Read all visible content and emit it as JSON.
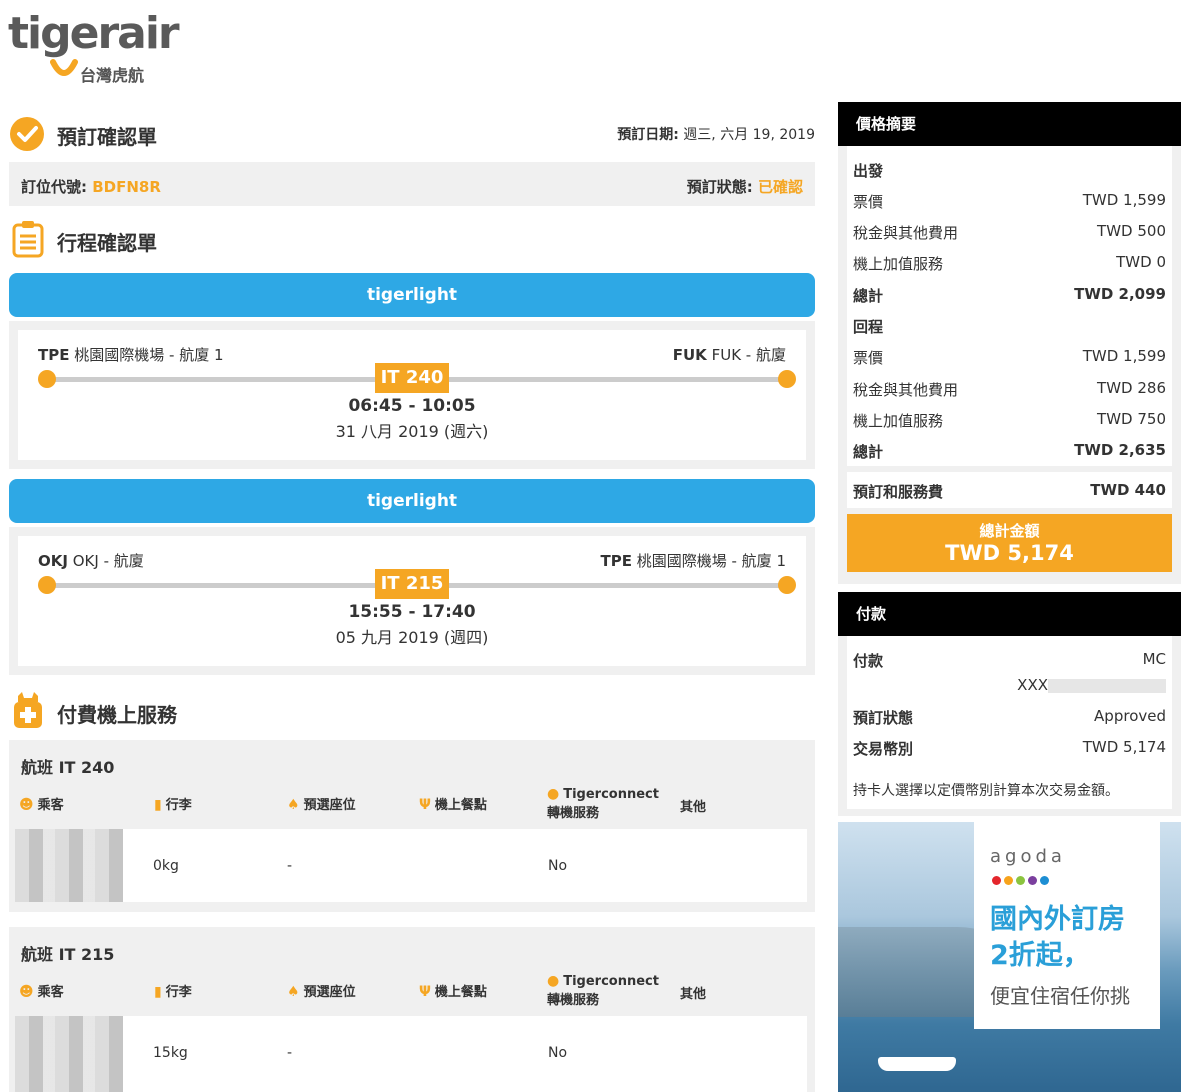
{
  "logo": {
    "word": "tigerair",
    "sub": "台灣虎航"
  },
  "booking": {
    "title": "預訂確認單",
    "date_label": "預訂日期:",
    "date_value": "週三, 六月 19, 2019",
    "pnr_label": "訂位代號:",
    "pnr_value": "BDFN8R",
    "status_label": "預訂狀態:",
    "status_value": "已確認"
  },
  "itinerary": {
    "title": "行程確認單",
    "flights": [
      {
        "fare": "tigerlight",
        "from_code": "TPE",
        "from_name": "桃園國際機場 - 航廈 1",
        "to_code": "FUK",
        "to_name": "FUK - 航廈",
        "flight_no": "IT 240",
        "time": "06:45 - 10:05",
        "date": "31 八月 2019 (週六)"
      },
      {
        "fare": "tigerlight",
        "from_code": "OKJ",
        "from_name": "OKJ - 航廈",
        "to_code": "TPE",
        "to_name": "桃園國際機場 - 航廈 1",
        "flight_no": "IT 215",
        "time": "15:55 - 17:40",
        "date": "05 九月 2019 (週四)"
      }
    ]
  },
  "services": {
    "title": "付費機上服務",
    "headers": {
      "pax": "乘客",
      "baggage": "行李",
      "seat": "預選座位",
      "meal": "機上餐點",
      "connect1": "Tigerconnect",
      "connect2": "轉機服務",
      "other": "其他"
    },
    "flights": [
      {
        "title": "航班 IT 240",
        "baggage": "0kg",
        "seat": "-",
        "connect": "No"
      },
      {
        "title": "航班 IT 215",
        "baggage": "15kg",
        "seat": "-",
        "connect": "No"
      }
    ]
  },
  "price": {
    "title": "價格摘要",
    "outbound": {
      "label": "出發",
      "rows": [
        {
          "l": "票價",
          "r": "TWD 1,599"
        },
        {
          "l": "稅金與其他費用",
          "r": "TWD 500"
        },
        {
          "l": "機上加值服務",
          "r": "TWD 0"
        }
      ],
      "total_l": "總計",
      "total_r": "TWD 2,099"
    },
    "return": {
      "label": "回程",
      "rows": [
        {
          "l": "票價",
          "r": "TWD 1,599"
        },
        {
          "l": "稅金與其他費用",
          "r": "TWD 286"
        },
        {
          "l": "機上加值服務",
          "r": "TWD 750"
        }
      ],
      "total_l": "總計",
      "total_r": "TWD 2,635"
    },
    "fee_l": "預訂和服務費",
    "fee_r": "TWD 440",
    "grand_label": "總計金額",
    "grand_value": "TWD 5,174"
  },
  "payment": {
    "title": "付款",
    "method_l": "付款",
    "method_r": "MC",
    "card": "XXX",
    "status_l": "預訂狀態",
    "status_r": "Approved",
    "currency_l": "交易幣別",
    "currency_r": "TWD 5,174",
    "note": "持卡人選擇以定價幣別計算本次交易金額。"
  },
  "ad": {
    "brand": "agoda",
    "line1": "國內外訂房",
    "line2": "2折起，",
    "line3": "便宜住宿任你挑",
    "dot_colors": [
      "#e4262c",
      "#f7a31c",
      "#8bc43f",
      "#7b3f9e",
      "#1d8ed3"
    ]
  }
}
